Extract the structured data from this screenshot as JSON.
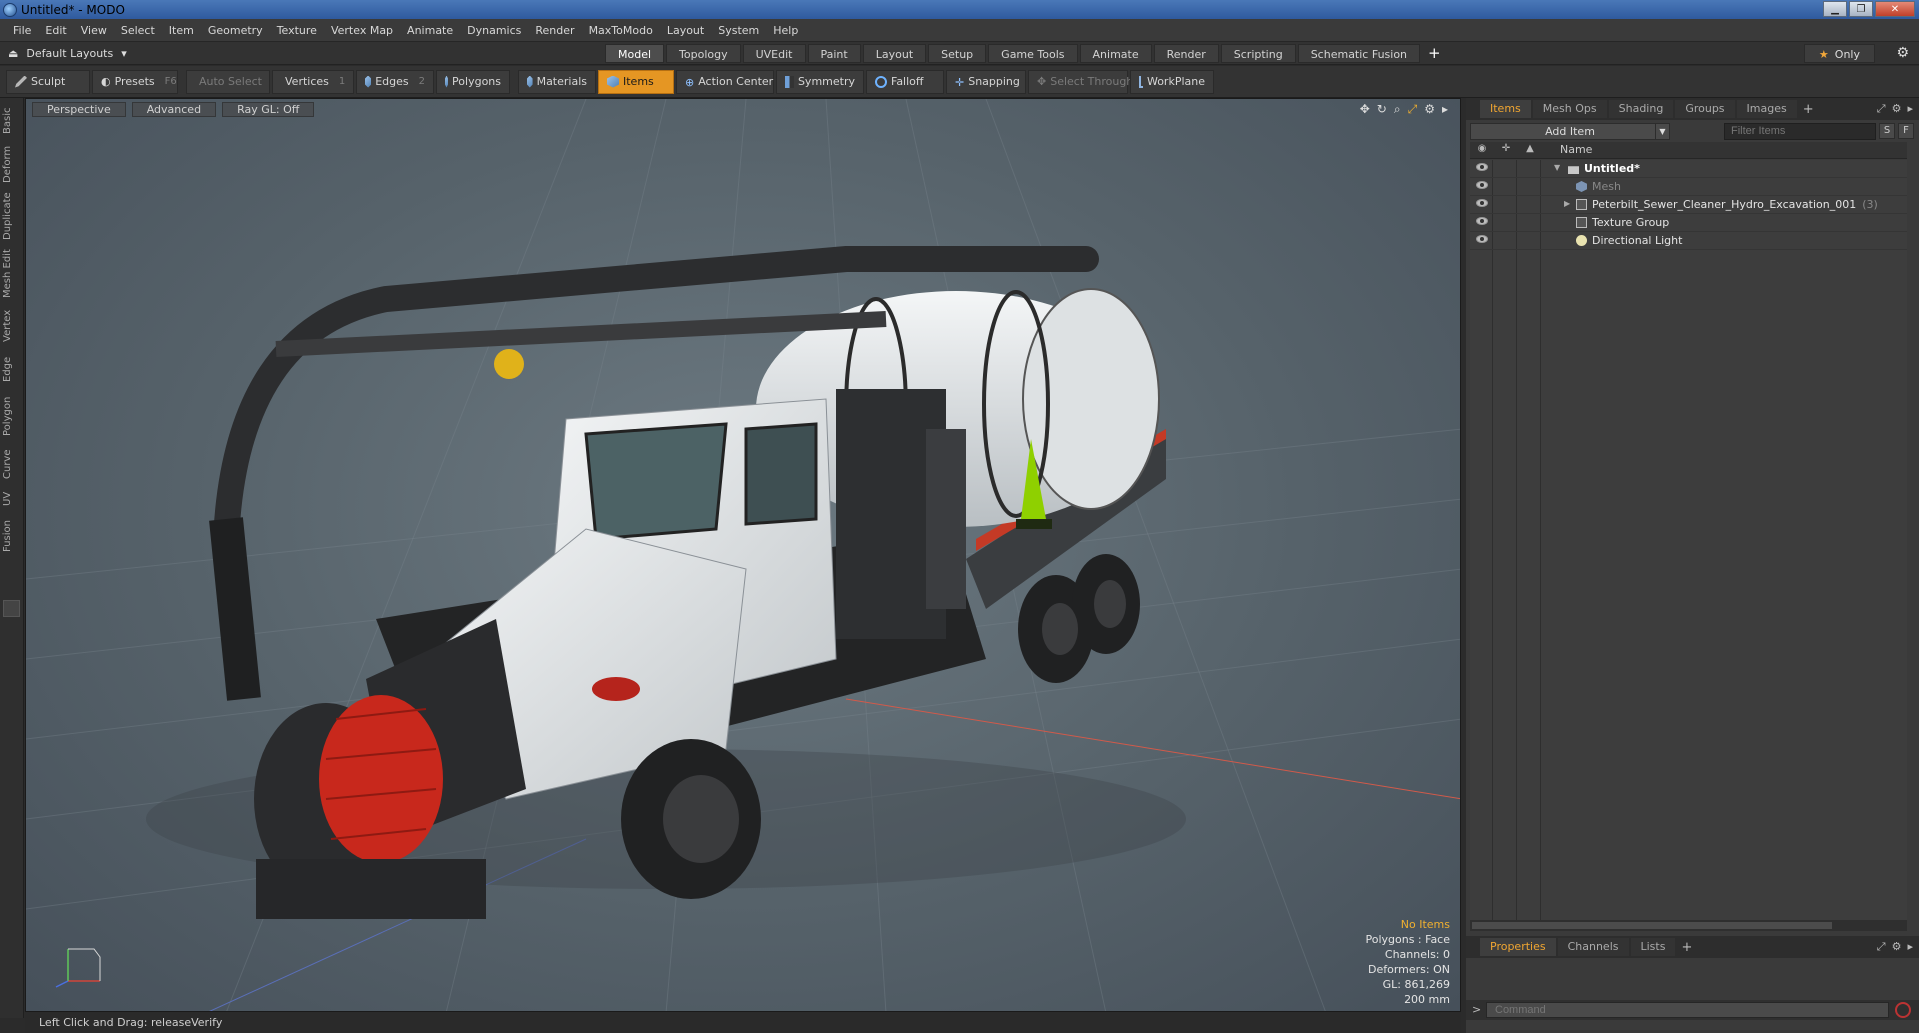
{
  "window": {
    "title": "Untitled* - MODO"
  },
  "menu": [
    "File",
    "Edit",
    "View",
    "Select",
    "Item",
    "Geometry",
    "Texture",
    "Vertex Map",
    "Animate",
    "Dynamics",
    "Render",
    "MaxToModo",
    "Layout",
    "System",
    "Help"
  ],
  "layoutbar": {
    "layouts_label": "Default Layouts",
    "tabs": [
      "Model",
      "Topology",
      "UVEdit",
      "Paint",
      "Layout",
      "Setup",
      "Game Tools",
      "Animate",
      "Render",
      "Scripting",
      "Schematic Fusion"
    ],
    "active_tab": "Model",
    "only_label": "Only"
  },
  "toolbar": {
    "sculpt": "Sculpt",
    "presets": "Presets",
    "presets_key": "F6",
    "auto_select": "Auto Select",
    "vertices": "Vertices",
    "vertices_key": "1",
    "edges": "Edges",
    "edges_key": "2",
    "polygons": "Polygons",
    "materials": "Materials",
    "items": "Items",
    "action_center": "Action Center",
    "symmetry": "Symmetry",
    "falloff": "Falloff",
    "snapping": "Snapping",
    "select_through": "Select Through",
    "workplane": "WorkPlane"
  },
  "left_tabs": [
    "Basic",
    "Deform",
    "Duplicate",
    "Mesh Edit",
    "Vertex",
    "Edge",
    "Polygon",
    "Curve",
    "UV",
    "Fusion"
  ],
  "viewport": {
    "view_mode": "Perspective",
    "advanced": "Advanced",
    "raygl": "Ray GL: Off",
    "stats": {
      "no_items": "No Items",
      "polygons": "Polygons : Face",
      "channels": "Channels: 0",
      "deformers": "Deformers: ON",
      "gl": "GL: 861,269",
      "scale": "200 mm"
    }
  },
  "status": {
    "text": "Left Click and Drag:  releaseVerify"
  },
  "items_panel": {
    "tabs": [
      "Items",
      "Mesh Ops",
      "Shading",
      "Groups",
      "Images"
    ],
    "active_tab": "Items",
    "add_item": "Add Item",
    "filter_placeholder": "Filter Items",
    "btn_s": "S",
    "btn_f": "F",
    "name_header": "Name",
    "rows": [
      {
        "label": "Untitled*",
        "bold": true
      },
      {
        "label": "Mesh",
        "dim": true
      },
      {
        "label": "Peterbilt_Sewer_Cleaner_Hydro_Excavation_001",
        "count": "(3)"
      },
      {
        "label": "Texture Group"
      },
      {
        "label": "Directional Light"
      }
    ]
  },
  "props_panel": {
    "tabs": [
      "Properties",
      "Channels",
      "Lists"
    ],
    "active_tab": "Properties",
    "command_placeholder": "Command"
  },
  "colors": {
    "accent": "#e59623",
    "tab_active_text": "#f0a632",
    "truck_white": "#e9ecee",
    "hose_red": "#c8281c",
    "cone_green": "#8fd000"
  }
}
